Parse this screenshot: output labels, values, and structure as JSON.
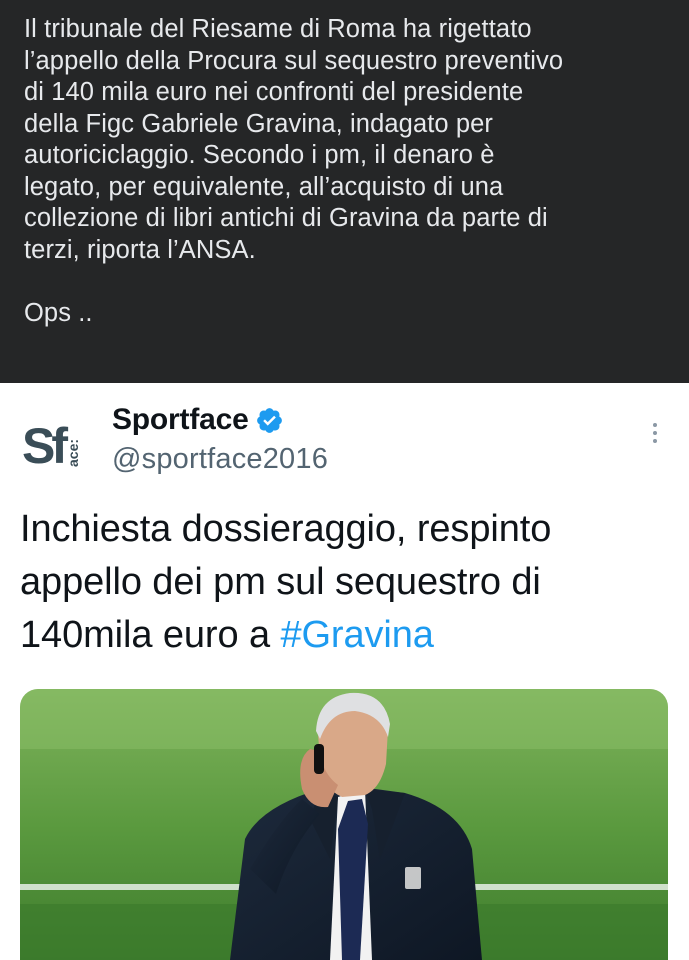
{
  "post": {
    "text": "Il tribunale del Riesame di Roma ha rigettato\nl’appello della Procura sul sequestro preventivo\ndi 140 mila euro nei confronti del presidente\ndella Figc Gabriele Gravina, indagato per\nautoriciclaggio. Secondo i pm, il denaro è\nlegato, per equivalente, all’acquisto di una\ncollezione di libri antichi di Gravina da parte di\nterzi, riporta l’ANSA.",
    "comment": "Ops .."
  },
  "tweet": {
    "author_name": "Sportface",
    "handle": "@sportface2016",
    "avatar_text": "Sf",
    "avatar_subtext": "ace:",
    "text_main": "Inchiesta dossieraggio, respinto\nappello dei pm sul sequestro di\n140mila euro a ",
    "hashtag": "#Gravina",
    "verified_icon": "verified-badge-icon",
    "more_icon": "more-vertical-icon",
    "colors": {
      "post_bg": "#252627",
      "hashtag": "#1d9bf0",
      "verified": "#1d9bf0",
      "avatar_text": "#3a4d57",
      "pitch": "#4c8f3a"
    },
    "media_alt": "photo"
  }
}
